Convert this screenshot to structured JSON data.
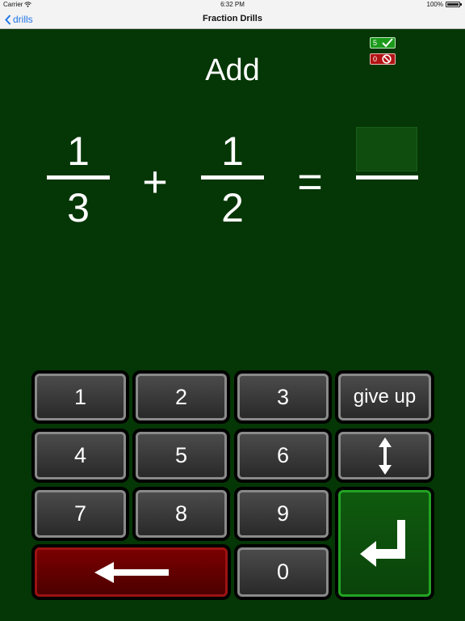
{
  "status_bar": {
    "carrier": "Carrier",
    "time": "6:32 PM",
    "battery": "100%",
    "battery_level": 1.0
  },
  "nav": {
    "back_label": "drills",
    "title": "Fraction Drills"
  },
  "drill": {
    "operation": "Add",
    "fraction1": {
      "numerator": "1",
      "denominator": "3"
    },
    "operator": "+",
    "fraction2": {
      "numerator": "1",
      "denominator": "2"
    },
    "equals": "=",
    "correct_count": "5",
    "wrong_count": "0"
  },
  "keypad": {
    "k1": "1",
    "k2": "2",
    "k3": "3",
    "give_up": "give up",
    "k4": "4",
    "k5": "5",
    "k6": "6",
    "k7": "7",
    "k8": "8",
    "k9": "9",
    "k0": "0"
  },
  "colors": {
    "background": "#053605",
    "key_gray": "#3a3a3a",
    "backspace_red": "#6a0000",
    "enter_green": "#0c4f0c",
    "nav_blue": "#1f76e8"
  },
  "icons": {
    "back": "chevron-left-icon",
    "correct": "checkmark-icon",
    "wrong": "no-entry-icon",
    "toggle": "up-down-arrow-icon",
    "backspace": "left-arrow-icon",
    "enter": "return-arrow-icon"
  }
}
